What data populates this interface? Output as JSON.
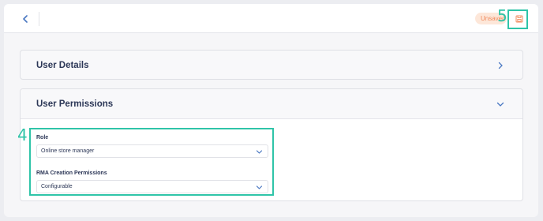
{
  "header": {
    "back_icon": "chevron-left-icon",
    "unsaved_label": "Unsaved",
    "save_icon": "save-icon"
  },
  "sections": {
    "user_details": {
      "title": "User Details",
      "icon": "chevron-right-icon"
    },
    "user_permissions": {
      "title": "User Permissions",
      "icon": "chevron-down-icon",
      "fields": {
        "role": {
          "label": "Role",
          "value": "Online store manager"
        },
        "rma": {
          "label": "RMA Creation Permissions",
          "value": "Configurable"
        }
      }
    }
  },
  "annotations": {
    "fields_marker": "4",
    "save_marker": "5"
  },
  "colors": {
    "accent": "#2fc4a8",
    "title": "#2c3757",
    "badge_bg": "#fde7d9",
    "badge_text": "#f08a5d",
    "icon_blue": "#4a78c2"
  }
}
